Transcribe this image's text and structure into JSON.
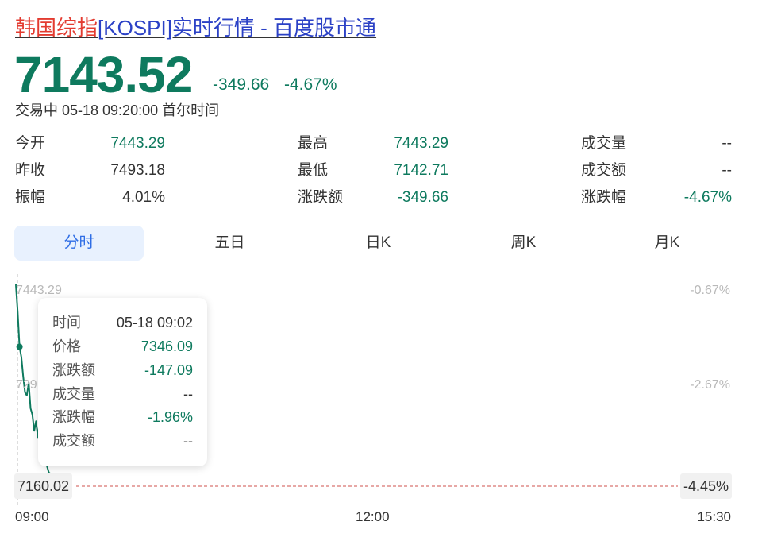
{
  "header": {
    "title_part1": "韩国综指",
    "title_part2": "[KOSPI]实时行情 - 百度股市通"
  },
  "quote": {
    "price": "7143.52",
    "change": "-349.66",
    "change_pct": "-4.67%",
    "status": "交易中 05-18 09:20:00 首尔时间"
  },
  "stats": {
    "col1": [
      {
        "label": "今开",
        "value": "7443.29"
      },
      {
        "label": "昨收",
        "value": "7493.18"
      },
      {
        "label": "振幅",
        "value": "4.01%"
      }
    ],
    "col2": [
      {
        "label": "最高",
        "value": "7443.29"
      },
      {
        "label": "最低",
        "value": "7142.71"
      },
      {
        "label": "涨跌额",
        "value": "-349.66"
      }
    ],
    "col3": [
      {
        "label": "成交量",
        "value": "--"
      },
      {
        "label": "成交额",
        "value": "--"
      },
      {
        "label": "涨跌幅",
        "value": "-4.67%"
      }
    ]
  },
  "tabs": [
    {
      "label": "分时",
      "active": true
    },
    {
      "label": "五日",
      "active": false
    },
    {
      "label": "日K",
      "active": false
    },
    {
      "label": "周K",
      "active": false
    },
    {
      "label": "月K",
      "active": false
    }
  ],
  "chart": {
    "y_left_top": "7443.29",
    "y_left_mid": "729",
    "y_right_top": "-0.67%",
    "y_right_mid": "-2.67%",
    "crosshair_price": "7160.02",
    "crosshair_pct": "-4.45%",
    "x_labels": [
      "09:00",
      "12:00",
      "15:30"
    ],
    "colors": {
      "line": "#0e7a5e",
      "ref_line": "#e7a8a6",
      "axis_text": "#b9b9b9"
    }
  },
  "tooltip": {
    "rows": [
      {
        "label": "时间",
        "value": "05-18 09:02"
      },
      {
        "label": "价格",
        "value": "7346.09"
      },
      {
        "label": "涨跌额",
        "value": "-147.09"
      },
      {
        "label": "成交量",
        "value": "--"
      },
      {
        "label": "涨跌幅",
        "value": "-1.96%"
      },
      {
        "label": "成交额",
        "value": "--"
      }
    ]
  },
  "chart_data": {
    "type": "line",
    "x": [
      "09:00",
      "09:01",
      "09:02",
      "09:03",
      "09:04",
      "09:05",
      "09:06",
      "09:07",
      "09:08",
      "09:09",
      "09:10",
      "09:11",
      "09:12",
      "09:13",
      "09:14",
      "09:15",
      "09:16",
      "09:17",
      "09:18",
      "09:19",
      "09:20"
    ],
    "series": [
      {
        "values": [
          7443.29,
          7400,
          7346.09,
          7330,
          7300,
          7275,
          7270,
          7290,
          7250,
          7240,
          7215,
          7230,
          7205,
          7232,
          7195,
          7185,
          7170,
          7160,
          7150,
          7148,
          7143.52
        ]
      }
    ],
    "ylim": [
      7143.52,
      7443.29
    ],
    "x_range": [
      "09:00",
      "15:30"
    ],
    "highlight": {
      "time": "09:02",
      "price": 7346.09
    }
  }
}
